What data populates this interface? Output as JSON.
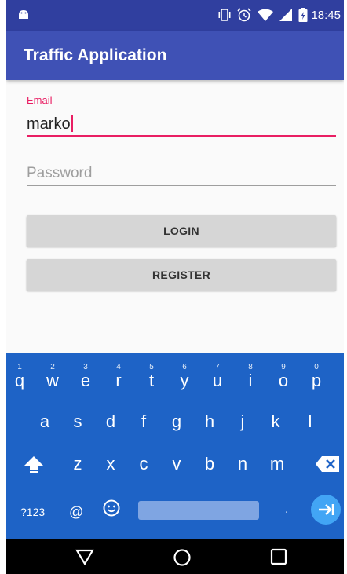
{
  "status_bar": {
    "time": "18:45",
    "icons": [
      "android-icon",
      "vibrate-icon",
      "alarm-icon",
      "wifi-icon",
      "signal-icon",
      "battery-icon"
    ]
  },
  "app_bar": {
    "title": "Traffic Application"
  },
  "form": {
    "email_label": "Email",
    "email_value": "marko",
    "password_placeholder": "Password",
    "login_label": "LOGIN",
    "register_label": "REGISTER"
  },
  "keyboard": {
    "row1": [
      {
        "key": "q",
        "num": "1"
      },
      {
        "key": "w",
        "num": "2"
      },
      {
        "key": "e",
        "num": "3"
      },
      {
        "key": "r",
        "num": "4"
      },
      {
        "key": "t",
        "num": "5"
      },
      {
        "key": "y",
        "num": "6"
      },
      {
        "key": "u",
        "num": "7"
      },
      {
        "key": "i",
        "num": "8"
      },
      {
        "key": "o",
        "num": "9"
      },
      {
        "key": "p",
        "num": "0"
      }
    ],
    "row2": [
      "a",
      "s",
      "d",
      "f",
      "g",
      "h",
      "j",
      "k",
      "l"
    ],
    "row3": [
      "z",
      "x",
      "c",
      "v",
      "b",
      "n",
      "m"
    ],
    "symbols_label": "?123",
    "at_label": "@",
    "period_label": "."
  },
  "colors": {
    "primary": "#3f51b5",
    "primary_dark": "#303f9f",
    "accent": "#e91e63",
    "keyboard_bg": "#1e63c6"
  }
}
